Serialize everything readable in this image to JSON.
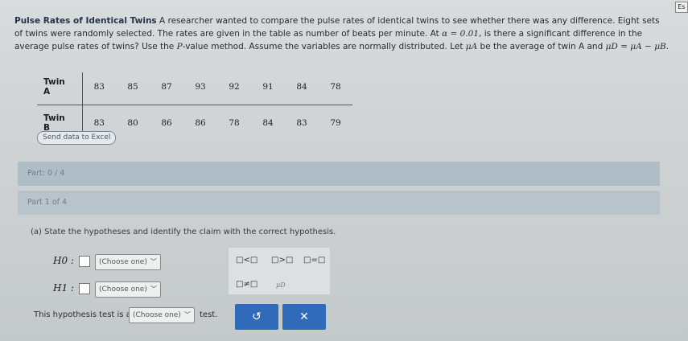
{
  "corner_label": "Es",
  "problem": {
    "lead": "Pulse Rates of Identical Twins",
    "text1": " A researcher wanted to compare the pulse rates of identical twins to see whether there was any difference. Eight sets of twins were randomly selected. The rates are given in the table as number of beats per minute. At ",
    "alpha": "α = 0.01",
    "text2": ", is there a significant difference in the average pulse rates of twins? Use the ",
    "pvalue": "P",
    "text3": "-value method. Assume the variables are normally distributed. Let ",
    "mu_a": "μA",
    "text4": " be the average of twin A and ",
    "mu_d": "μD = μA − μB",
    "text5": "."
  },
  "table": {
    "row_a_label": "Twin A",
    "row_a": [
      "83",
      "85",
      "87",
      "93",
      "92",
      "91",
      "84",
      "78"
    ],
    "row_b_label": "Twin B",
    "row_b": [
      "83",
      "80",
      "86",
      "86",
      "78",
      "84",
      "83",
      "79"
    ]
  },
  "excel_button": "Send data to Excel",
  "part_progress": "Part: 0 / 4",
  "part_label": "Part 1 of 4",
  "prompt": "(a) State the hypotheses and identify the claim with the correct hypothesis.",
  "h0_label": "H0 :",
  "h1_label": "H1 :",
  "h0_select": "(Choose one)",
  "h1_select": "(Choose one)",
  "symbols": {
    "lt": "□<□",
    "gt": "□>□",
    "eq": "□=□",
    "ne": "□≠□",
    "mu": "μD"
  },
  "test_prefix": "This hypothesis test is a",
  "test_select": "(Choose one)",
  "test_suffix": "test.",
  "undo_icon": "undo-icon",
  "clear_icon": "close-icon"
}
